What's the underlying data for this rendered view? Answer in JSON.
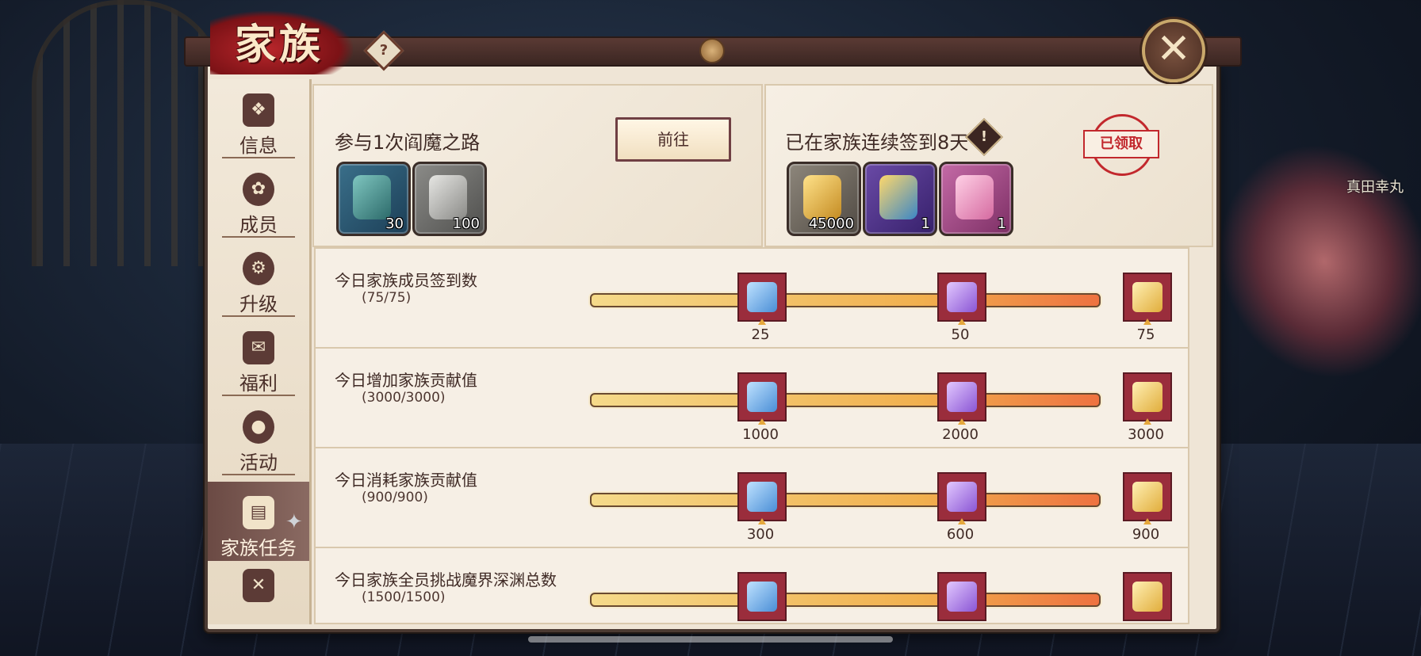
{
  "window": {
    "title": "家族",
    "help_symbol": "?",
    "close_symbol": "✕"
  },
  "background": {
    "npc_name": "真田幸丸"
  },
  "sidebar": {
    "items": [
      {
        "label": "信息",
        "icon": "info-icon",
        "active": false
      },
      {
        "label": "成员",
        "icon": "members-icon",
        "active": false
      },
      {
        "label": "升级",
        "icon": "upgrade-icon",
        "active": false
      },
      {
        "label": "福利",
        "icon": "gift-icon",
        "active": false
      },
      {
        "label": "活动",
        "icon": "daruma-icon",
        "active": false
      },
      {
        "label": "家族任务",
        "icon": "scroll-icon",
        "active": true
      },
      {
        "label": "",
        "icon": "crossed-weapons-icon",
        "active": false
      }
    ]
  },
  "quest_card": {
    "title": "参与1次阎魔之路",
    "button_label": "前往",
    "rewards": [
      {
        "name": "jade-token-icon",
        "count": "30",
        "quality": "blue"
      },
      {
        "name": "iron-ore-icon",
        "count": "100",
        "quality": "gray"
      }
    ]
  },
  "signin_card": {
    "title": "已在家族连续签到8天",
    "info_symbol": "!",
    "stamp_label": "已领取",
    "rewards": [
      {
        "name": "gold-coin-icon",
        "count": "45000",
        "quality": "gray"
      },
      {
        "name": "gold-rune-icon",
        "count": "1",
        "quality": "purple"
      },
      {
        "name": "pink-crystal-icon",
        "count": "1",
        "quality": "pink"
      }
    ]
  },
  "tasks": [
    {
      "title": "今日家族成员签到数",
      "progress": "(75/75)",
      "fill_fraction": 1.0,
      "milestones": [
        "25",
        "50",
        "75"
      ]
    },
    {
      "title": "今日增加家族贡献值",
      "progress": "(3000/3000)",
      "fill_fraction": 1.0,
      "milestones": [
        "1000",
        "2000",
        "3000"
      ]
    },
    {
      "title": "今日消耗家族贡献值",
      "progress": "(900/900)",
      "fill_fraction": 1.0,
      "milestones": [
        "300",
        "600",
        "900"
      ]
    },
    {
      "title": "今日家族全员挑战魔界深渊总数",
      "progress": "(1500/1500)",
      "fill_fraction": 1.0,
      "milestones": [
        "",
        "",
        ""
      ]
    }
  ],
  "colors": {
    "panel_bg": "#efe5d6",
    "accent_red": "#c2282d",
    "chest_frame": "#9a2d3c",
    "bar_start": "#f5da8a",
    "bar_end": "#ee7240"
  }
}
